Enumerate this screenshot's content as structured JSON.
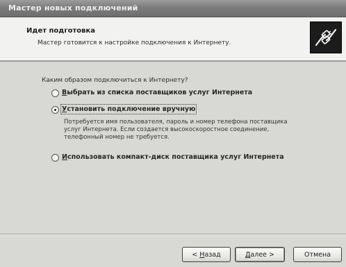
{
  "window": {
    "title": "Мастер новых подключений"
  },
  "header": {
    "title": "Идет подготовка",
    "subtitle": "Мастер готовится к настройке подключения к Интернету.",
    "icon": "network-connection-icon"
  },
  "content": {
    "question": "Каким образом подключиться к Интернету?",
    "options": [
      {
        "accel": "В",
        "rest": "ыбрать из списка поставщиков услуг Интернета",
        "selected": false
      },
      {
        "accel": "У",
        "rest": "становить подключение вручную",
        "selected": true
      },
      {
        "accel": "И",
        "rest": "спользовать компакт-диск поставщика услуг Интернета",
        "selected": false
      }
    ],
    "selected_description": [
      "Потребуется имя пользователя, пароль и номер телефона поставщика",
      "услуг Интернета. Если создается высокоскоростное соединение,",
      "телефонный номер не требуется."
    ]
  },
  "buttons": {
    "back": {
      "prefix": "< ",
      "accel": "Н",
      "rest": "азад"
    },
    "next": {
      "accel": "Д",
      "rest": "алее",
      "suffix": " >"
    },
    "cancel": {
      "label": "Отмена"
    }
  }
}
